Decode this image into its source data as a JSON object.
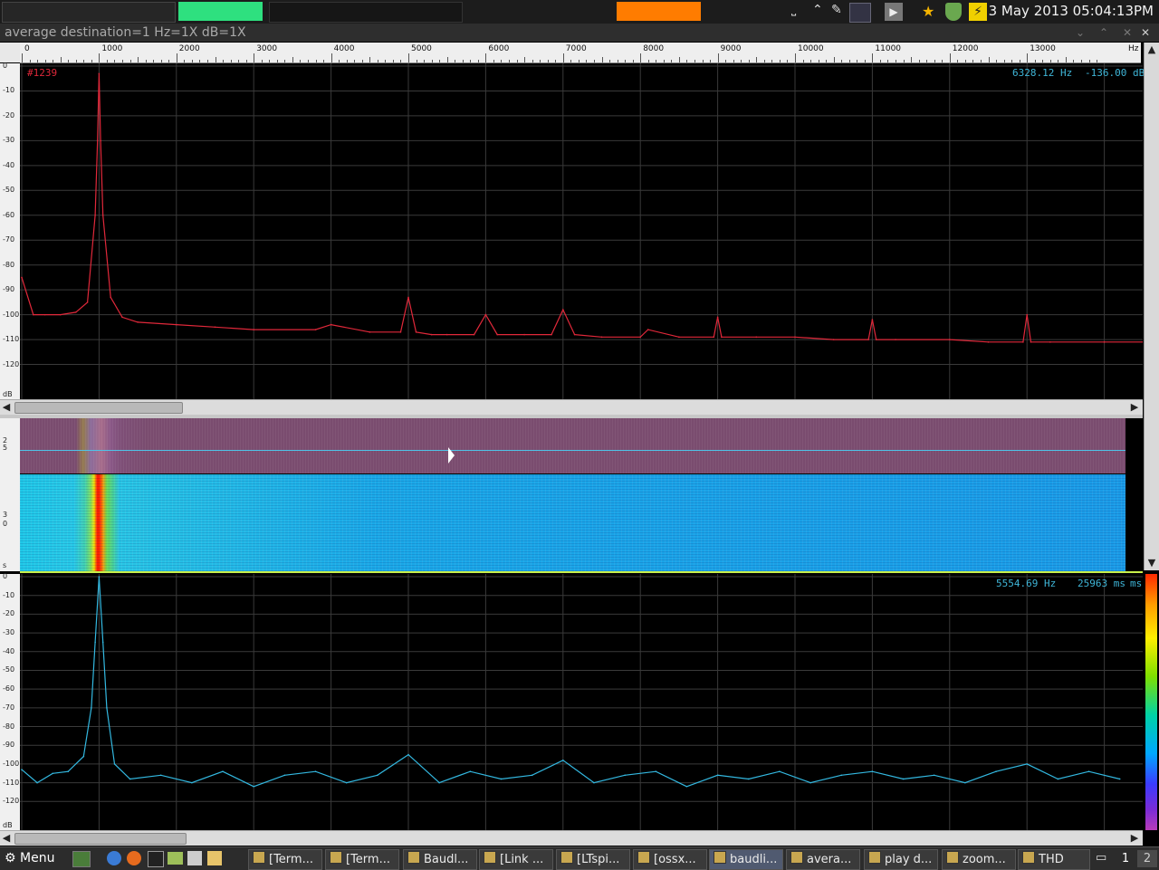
{
  "system_bar": {
    "clock": "3 May 2013 05:04:13PM",
    "meters": [
      {
        "name": "cpu-meter",
        "color": "#2a2a2a"
      },
      {
        "name": "memory-meter",
        "color": "#2ee07f"
      },
      {
        "name": "network-meter",
        "color": "#1f1f1f"
      },
      {
        "name": "disk-meter",
        "color": "#ff7c00"
      }
    ],
    "tray_icons": [
      "keyboard-icon",
      "chevron-up-icon",
      "pen-icon",
      "network-icon",
      "play-icon",
      "star-icon",
      "shield-icon",
      "power-icon"
    ]
  },
  "window": {
    "title": "average    destination=1 Hz=1X dB=1X"
  },
  "ruler": {
    "ticks": [
      "0",
      "1000",
      "2000",
      "3000",
      "4000",
      "5000",
      "6000",
      "7000",
      "8000",
      "9000",
      "10000",
      "11000",
      "12000",
      "13000"
    ],
    "unit": "Hz"
  },
  "top_plot": {
    "frame_label": "#1239",
    "readout_freq": "6328.12 Hz",
    "readout_db": "-136.00 dB",
    "y_ticks": [
      "0",
      "-10",
      "-20",
      "-30",
      "-40",
      "-50",
      "-60",
      "-70",
      "-80",
      "-90",
      "-100",
      "-110",
      "-120",
      "dB"
    ],
    "color": "#e0283a"
  },
  "waterfall": {
    "left_labels_upper": [
      "2",
      "5"
    ],
    "left_labels_lower": [
      "3",
      "0",
      "s"
    ]
  },
  "bottom_plot": {
    "readout_freq": "5554.69 Hz",
    "readout_time": "25963 ms",
    "readout_unit": "ms",
    "y_ticks": [
      "0",
      "-10",
      "-20",
      "-30",
      "-40",
      "-50",
      "-60",
      "-70",
      "-80",
      "-90",
      "-100",
      "-110",
      "-120",
      "dB"
    ],
    "color": "#33b8e0"
  },
  "taskbar": {
    "menu_label": "Menu",
    "tasks": [
      "[Term...",
      "[Term...",
      "Baudl...",
      "[Link ...",
      "[LTspi...",
      "[ossx...",
      "baudli...",
      "avera...",
      "play d...",
      "zoom...",
      "THD"
    ],
    "active_task": 6,
    "workspaces": [
      "1",
      "2"
    ]
  },
  "chart_data": [
    {
      "type": "line",
      "title": "",
      "xlabel": "Hz",
      "ylabel": "dB",
      "xlim": [
        0,
        14500
      ],
      "ylim": [
        -130,
        0
      ],
      "series": [
        {
          "x": [
            0,
            150,
            300,
            500,
            700,
            850,
            950,
            980,
            1000,
            1020,
            1050,
            1150,
            1300,
            1500,
            2000,
            2500,
            3000,
            3800,
            4000,
            4500,
            4900,
            5000,
            5100,
            5300,
            5500,
            5850,
            6000,
            6150,
            6500,
            6850,
            7000,
            7150,
            7500,
            8000,
            8100,
            8500,
            8950,
            9000,
            9050,
            9500,
            10000,
            10500,
            10950,
            11000,
            11050,
            11300,
            12000,
            12500,
            12950,
            13000,
            13050,
            13300,
            14000,
            14500
          ],
          "y": [
            -85,
            -100,
            -100,
            -100,
            -99,
            -95,
            -60,
            -30,
            -3,
            -30,
            -60,
            -93,
            -101,
            -103,
            -104,
            -105,
            -106,
            -106,
            -104,
            -107,
            -107,
            -93,
            -107,
            -108,
            -108,
            -108,
            -100,
            -108,
            -108,
            -108,
            -98,
            -108,
            -109,
            -109,
            -106,
            -109,
            -109,
            -101,
            -109,
            -109,
            -109,
            -110,
            -110,
            -102,
            -110,
            -110,
            -110,
            -111,
            -111,
            -100,
            -111,
            -111,
            -111,
            -111
          ]
        }
      ]
    },
    {
      "type": "line",
      "title": "",
      "xlabel": "Hz",
      "ylabel": "dB",
      "xlim": [
        0,
        14500
      ],
      "ylim": [
        -130,
        0
      ],
      "series": [
        {
          "x": [
            0,
            200,
            400,
            600,
            800,
            900,
            950,
            1000,
            1050,
            1100,
            1200,
            1400,
            1800,
            2200,
            2600,
            3000,
            3400,
            3800,
            4200,
            4600,
            5000,
            5400,
            5800,
            6200,
            6600,
            7000,
            7400,
            7800,
            8200,
            8600,
            9000,
            9400,
            9800,
            10200,
            10600,
            11000,
            11400,
            11800,
            12200,
            12600,
            13000,
            13400,
            13800,
            14200
          ],
          "y": [
            -103,
            -110,
            -105,
            -104,
            -96,
            -70,
            -35,
            0,
            -35,
            -70,
            -100,
            -108,
            -106,
            -110,
            -104,
            -112,
            -106,
            -104,
            -110,
            -106,
            -95,
            -110,
            -104,
            -108,
            -106,
            -98,
            -110,
            -106,
            -104,
            -112,
            -106,
            -108,
            -104,
            -110,
            -106,
            -104,
            -108,
            -106,
            -110,
            -104,
            -100,
            -108,
            -104,
            -108
          ]
        }
      ]
    }
  ]
}
